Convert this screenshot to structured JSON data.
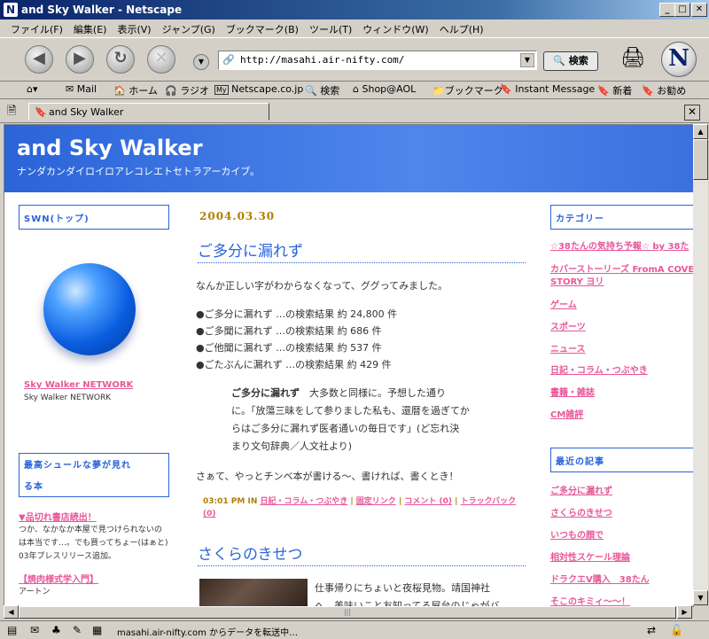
{
  "window": {
    "title": "and Sky Walker - Netscape",
    "logo_letter": "N"
  },
  "menu": [
    "ファイル(F)",
    "編集(E)",
    "表示(V)",
    "ジャンプ(G)",
    "ブックマーク(B)",
    "ツール(T)",
    "ウィンドウ(W)",
    "ヘルプ(H)"
  ],
  "nav": {
    "url": "http://masahi.air-nifty.com/",
    "search_label": "検索",
    "logo_letter": "N"
  },
  "personal": [
    "Mail",
    "ホーム",
    "ラジオ",
    "Netscape.co.jp",
    "検索",
    "Shop@AOL",
    "ブックマーク",
    "Instant Message",
    "新着",
    "お勧め"
  ],
  "tab": {
    "label": "and Sky Walker"
  },
  "blog": {
    "title": "and Sky Walker",
    "description": "ナンダカンダイロイロアレコレエトセトラアーカイブ。",
    "left": {
      "box1": "SWN(トップ)",
      "network_link": "Sky Walker NETWORK",
      "network_text": "Sky Walker NETWORK",
      "box2_line1": "最高シュールな夢が見れ",
      "box2_line2": "る本",
      "book_link": "▼品切れ書店続出！",
      "book_text1": "つか、なかなか本屋で見つけられないの",
      "book_text2": "は本当です…。でも買ってちょー(はぁと)",
      "book_text3": "03年プレスリリース追加。",
      "book2_link": "【焼肉様式学入門】",
      "book2_text": "アートン"
    },
    "post": {
      "date": "2004.03.30",
      "title": "ご多分に漏れず",
      "intro": "なんか正しい字がわからなくなって、ググってみました。",
      "results": [
        "●ご多分に漏れず …の検索結果 約 24,800 件",
        "●ご多聞に漏れず …の検索結果 約 686 件",
        "●ご他聞に漏れず …の検索結果 約 537 件",
        "●ごたぶんに漏れず …の検索結果 約 429 件"
      ],
      "quote_bold": "ご多分に漏れず",
      "quote_line1": "大多数と同様に。予想した通り",
      "quote_line2": "に。「放蕩三昧をして参りました私も、還暦を過ぎてか",
      "quote_line3": "らはご多分に漏れず医者通いの毎日です」(ど忘れ決",
      "quote_line4": "まり文句辞典／人文社より)",
      "closing": "さぁて、やっとチンベ本が書ける～、書ければ、書くとき！",
      "footer_time": "03:01 PM IN",
      "footer_cat": "日記・コラム・つぶやき",
      "footer_perma": "固定リンク",
      "footer_comment": "コメント (0)",
      "footer_tb": "トラックバック (0)"
    },
    "post2": {
      "title": "さくらのきせつ",
      "line1": "仕事帰りにちょいと夜桜見物。靖国神社",
      "line2": "へ。美味いこと友知ってる屋台のじゃがバ"
    },
    "right": {
      "cat_header": "カテゴリー",
      "categories": [
        "☆38たんの気持ち予報☆ by 38た",
        "カバーストーリーズ FromA COVER",
        "STORY ヨリ",
        "ゲーム",
        "スポーツ",
        "ニュース",
        "日記・コラム・つぶやき",
        "書籍・雑誌",
        "CM雑評"
      ],
      "recent_header": "最近の記事",
      "recent": [
        "ご多分に漏れず",
        "さくらのきせつ",
        "いつもの顔で",
        "相対性スケール理論",
        "ドラクエV購入　38たん",
        "そこのキミィ～～！"
      ]
    }
  },
  "status": {
    "text": "masahi.air-nifty.com からデータを転送中…"
  }
}
